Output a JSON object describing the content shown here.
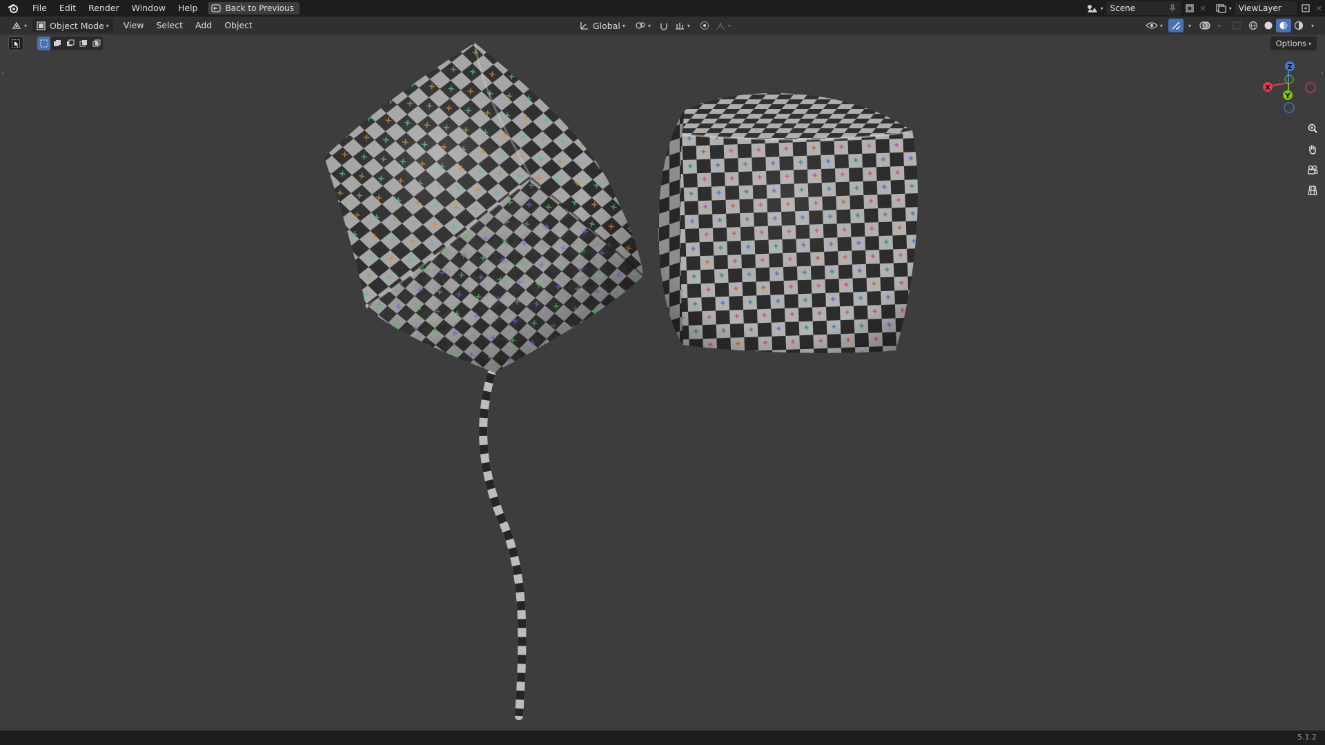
{
  "app": {
    "name": "Blender",
    "version": "5.1.2"
  },
  "menu": {
    "file": "File",
    "edit": "Edit",
    "render": "Render",
    "window": "Window",
    "help": "Help"
  },
  "topbar": {
    "back_label": "Back to Previous",
    "scene": "Scene",
    "view_layer": "ViewLayer"
  },
  "header": {
    "mode": "Object Mode",
    "menus": {
      "view": "View",
      "select": "Select",
      "add": "Add",
      "object": "Object"
    },
    "orientation": "Global"
  },
  "viewport": {
    "options_label": "Options",
    "gizmo": {
      "x": "X",
      "y": "Y",
      "z": "Z"
    },
    "background_color": "#3d3d3d",
    "objects": [
      "checkered balloon (rotated cube)",
      "checkered pillow cube",
      "balloon string"
    ]
  },
  "icons": [
    "blender-logo-icon",
    "back-icon",
    "editor-type-icon",
    "object-mode-icon",
    "select-tool-icon",
    "scene-icon",
    "pin-icon",
    "new-scene-icon",
    "view-layer-icon",
    "orientation-icon",
    "pivot-icon",
    "snap-icon",
    "proportional-edit-icon",
    "visibility-icon",
    "gizmo-icon",
    "overlay-icon",
    "xray-icon",
    "wireframe-shading-icon",
    "solid-shading-icon",
    "material-shading-icon",
    "rendered-shading-icon",
    "zoom-icon",
    "pan-hand-icon",
    "camera-icon",
    "grid-icon"
  ],
  "colors": {
    "axis_x": "#e23b52",
    "axis_y": "#7dbf1e",
    "axis_z": "#3b7fdc",
    "active_blue": "#4772b3"
  }
}
